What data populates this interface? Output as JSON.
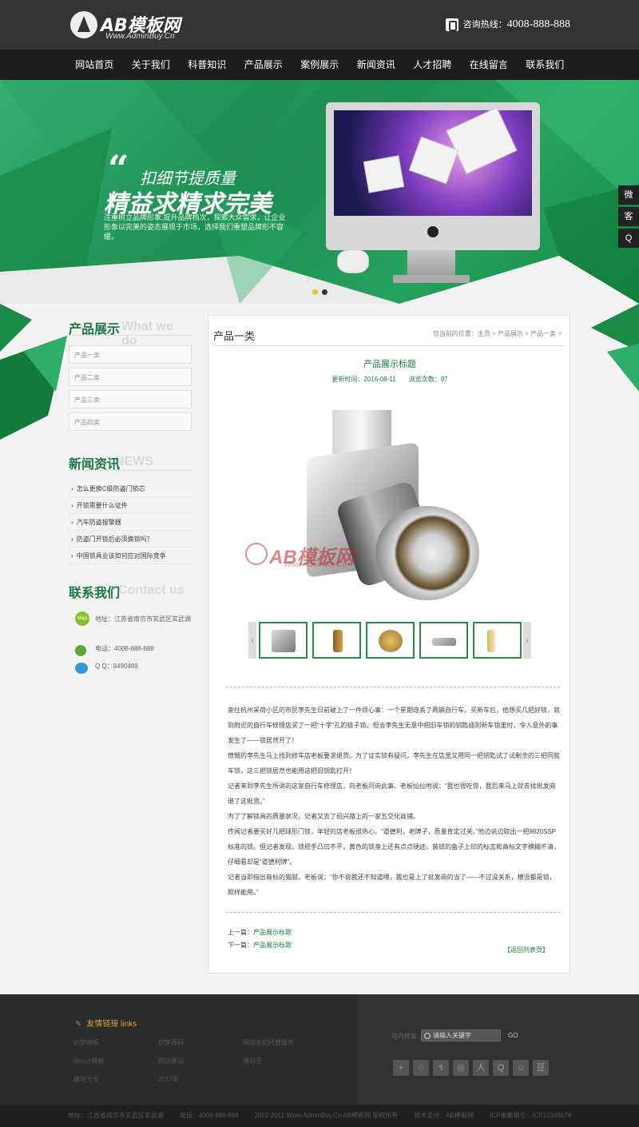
{
  "header": {
    "logo_text": "AB模板网",
    "logo_sub": "Www.AdminBuy.Cn",
    "hotline_label": "咨询热线：",
    "hotline_number": "4008-888-888"
  },
  "nav": [
    "网站首页",
    "关于我们",
    "科普知识",
    "产品展示",
    "案例展示",
    "新闻资讯",
    "人才招聘",
    "在线留言",
    "联系我们"
  ],
  "banner": {
    "line1": "扣细节提质量",
    "line2": "精益求精求完美",
    "desc": "注重树立品牌形象,提升品牌档次，探索大众需求，让企业形象以完美的姿态展现于市场，选择我们重塑品牌形不容缓。",
    "active_dot_color": "#f0c419"
  },
  "float_bar": [
    "微",
    "客",
    "Q"
  ],
  "sidebar": {
    "products_title": "产品展示",
    "products_title_en": "What we do",
    "products": [
      "产品一类",
      "产品二类",
      "产品三类",
      "产品四类"
    ],
    "news_title": "新闻资讯",
    "news_title_en": "NEWS",
    "news": [
      "怎么更换C级防盗门锁芯",
      "开锁需要什么证件",
      "汽车防盗报警器",
      "防盗门开锁后必须换锁吗？",
      "中国锁具业该如何应对国际竞争"
    ],
    "contact_title": "联系我们",
    "contact_title_en": "Contact us",
    "address": "地址：江苏省南京市玄武区玄武湖",
    "phone": "电话：4008-888-888",
    "qq": "Q Q：9490489",
    "map_label": "Map"
  },
  "main": {
    "section_title": "产品一类",
    "breadcrumb": "您当前的位置：主页 > 产品展示 > 产品一类 >",
    "product_title": "产品展示标题",
    "update_time": "更新时间：2016-08-11",
    "views": "浏览次数：97",
    "watermark": "AB模板网",
    "watermark_sub": "Www.AdminBuy.Cn",
    "paragraphs": [
      "家住杭州采荷小区的市民李先生日前碰上了一件烦心事：一个星期连丢了两辆自行车。买新车后，他想买几把好锁，就到附近的自行车修理店买了一把“十字”孔的链子锁。但当李先生无意中把旧车锁的钥匙插到新车锁里时，令人意外的事发生了——锁居然开了！",
      "愤慨的李先生马上找到修车店老板要求退货。为了证实锁有疑问，李先生在店里又用同一把钥匙试了试剩余的三把同款车锁，这三把锁居然也能用这把旧钥匙打开！",
      "记者来到李先生所说的这家自行车修理店，向老板问询此事。老板仙仙地说：“我也很吃惊，我后来马上就去找批发商退了这批货。”",
      "为了了解锁具的质量状况，记者又去了绍兴路上的一家五交化商铺。",
      "传闻记者要买好几把球形门锁，年轻的店老板很热心。“道德利，老牌子，质量肯定过关。”他边说边取出一把9820SSP标准的锁。但记者发现，锁把手凸凹不平，黄色的锁身上还有点点锈迹，装锁的盒子上印的标志和商标文字模糊不清，仔细看却是“道德利牌”。",
      "记者当即指出商标的猫腻，老板说：“你不说我还不知道哩，我也是上了批发商的当了——不过没关系，横竖都是锁，照样能用。”"
    ],
    "prev_label": "上一篇：",
    "prev_link": "产品展示标题",
    "next_label": "下一篇：",
    "next_link": "产品展示标题",
    "back": "【返回列表页】"
  },
  "footer": {
    "links_title": "友情链接 links",
    "links": [
      "织梦模板",
      "织梦源码",
      "网站主机托管服务",
      "discuz模板",
      "网站建设",
      "建站王",
      "建站大全",
      "2017年"
    ],
    "search_label": "站内搜索",
    "search_placeholder": "请输入关键字",
    "go": "GO",
    "share_icons": [
      "+",
      "☆",
      "ร",
      "◎",
      "人",
      "Q",
      "☺",
      "豆"
    ]
  },
  "copyright": [
    "地址：江苏省南京市玄武区玄武湖",
    "电话：4008-888-888",
    "2002-2011 Www.AdminBuy.Cn AB模板网 版权所有",
    "技术支持：AB模板网",
    "ICP备案编号：ICP12345678"
  ]
}
